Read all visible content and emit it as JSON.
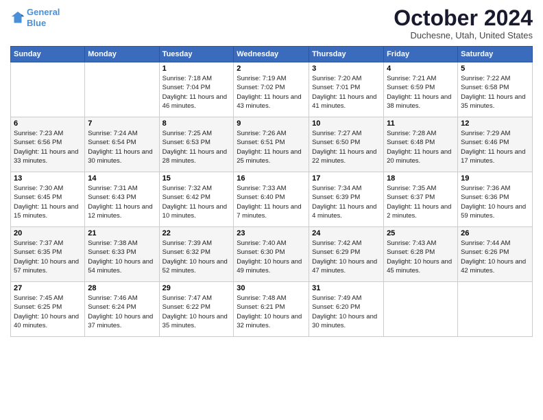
{
  "logo": {
    "line1": "General",
    "line2": "Blue"
  },
  "title": "October 2024",
  "location": "Duchesne, Utah, United States",
  "weekdays": [
    "Sunday",
    "Monday",
    "Tuesday",
    "Wednesday",
    "Thursday",
    "Friday",
    "Saturday"
  ],
  "weeks": [
    [
      {
        "day": "",
        "info": ""
      },
      {
        "day": "",
        "info": ""
      },
      {
        "day": "1",
        "info": "Sunrise: 7:18 AM\nSunset: 7:04 PM\nDaylight: 11 hours and 46 minutes."
      },
      {
        "day": "2",
        "info": "Sunrise: 7:19 AM\nSunset: 7:02 PM\nDaylight: 11 hours and 43 minutes."
      },
      {
        "day": "3",
        "info": "Sunrise: 7:20 AM\nSunset: 7:01 PM\nDaylight: 11 hours and 41 minutes."
      },
      {
        "day": "4",
        "info": "Sunrise: 7:21 AM\nSunset: 6:59 PM\nDaylight: 11 hours and 38 minutes."
      },
      {
        "day": "5",
        "info": "Sunrise: 7:22 AM\nSunset: 6:58 PM\nDaylight: 11 hours and 35 minutes."
      }
    ],
    [
      {
        "day": "6",
        "info": "Sunrise: 7:23 AM\nSunset: 6:56 PM\nDaylight: 11 hours and 33 minutes."
      },
      {
        "day": "7",
        "info": "Sunrise: 7:24 AM\nSunset: 6:54 PM\nDaylight: 11 hours and 30 minutes."
      },
      {
        "day": "8",
        "info": "Sunrise: 7:25 AM\nSunset: 6:53 PM\nDaylight: 11 hours and 28 minutes."
      },
      {
        "day": "9",
        "info": "Sunrise: 7:26 AM\nSunset: 6:51 PM\nDaylight: 11 hours and 25 minutes."
      },
      {
        "day": "10",
        "info": "Sunrise: 7:27 AM\nSunset: 6:50 PM\nDaylight: 11 hours and 22 minutes."
      },
      {
        "day": "11",
        "info": "Sunrise: 7:28 AM\nSunset: 6:48 PM\nDaylight: 11 hours and 20 minutes."
      },
      {
        "day": "12",
        "info": "Sunrise: 7:29 AM\nSunset: 6:46 PM\nDaylight: 11 hours and 17 minutes."
      }
    ],
    [
      {
        "day": "13",
        "info": "Sunrise: 7:30 AM\nSunset: 6:45 PM\nDaylight: 11 hours and 15 minutes."
      },
      {
        "day": "14",
        "info": "Sunrise: 7:31 AM\nSunset: 6:43 PM\nDaylight: 11 hours and 12 minutes."
      },
      {
        "day": "15",
        "info": "Sunrise: 7:32 AM\nSunset: 6:42 PM\nDaylight: 11 hours and 10 minutes."
      },
      {
        "day": "16",
        "info": "Sunrise: 7:33 AM\nSunset: 6:40 PM\nDaylight: 11 hours and 7 minutes."
      },
      {
        "day": "17",
        "info": "Sunrise: 7:34 AM\nSunset: 6:39 PM\nDaylight: 11 hours and 4 minutes."
      },
      {
        "day": "18",
        "info": "Sunrise: 7:35 AM\nSunset: 6:37 PM\nDaylight: 11 hours and 2 minutes."
      },
      {
        "day": "19",
        "info": "Sunrise: 7:36 AM\nSunset: 6:36 PM\nDaylight: 10 hours and 59 minutes."
      }
    ],
    [
      {
        "day": "20",
        "info": "Sunrise: 7:37 AM\nSunset: 6:35 PM\nDaylight: 10 hours and 57 minutes."
      },
      {
        "day": "21",
        "info": "Sunrise: 7:38 AM\nSunset: 6:33 PM\nDaylight: 10 hours and 54 minutes."
      },
      {
        "day": "22",
        "info": "Sunrise: 7:39 AM\nSunset: 6:32 PM\nDaylight: 10 hours and 52 minutes."
      },
      {
        "day": "23",
        "info": "Sunrise: 7:40 AM\nSunset: 6:30 PM\nDaylight: 10 hours and 49 minutes."
      },
      {
        "day": "24",
        "info": "Sunrise: 7:42 AM\nSunset: 6:29 PM\nDaylight: 10 hours and 47 minutes."
      },
      {
        "day": "25",
        "info": "Sunrise: 7:43 AM\nSunset: 6:28 PM\nDaylight: 10 hours and 45 minutes."
      },
      {
        "day": "26",
        "info": "Sunrise: 7:44 AM\nSunset: 6:26 PM\nDaylight: 10 hours and 42 minutes."
      }
    ],
    [
      {
        "day": "27",
        "info": "Sunrise: 7:45 AM\nSunset: 6:25 PM\nDaylight: 10 hours and 40 minutes."
      },
      {
        "day": "28",
        "info": "Sunrise: 7:46 AM\nSunset: 6:24 PM\nDaylight: 10 hours and 37 minutes."
      },
      {
        "day": "29",
        "info": "Sunrise: 7:47 AM\nSunset: 6:22 PM\nDaylight: 10 hours and 35 minutes."
      },
      {
        "day": "30",
        "info": "Sunrise: 7:48 AM\nSunset: 6:21 PM\nDaylight: 10 hours and 32 minutes."
      },
      {
        "day": "31",
        "info": "Sunrise: 7:49 AM\nSunset: 6:20 PM\nDaylight: 10 hours and 30 minutes."
      },
      {
        "day": "",
        "info": ""
      },
      {
        "day": "",
        "info": ""
      }
    ]
  ]
}
